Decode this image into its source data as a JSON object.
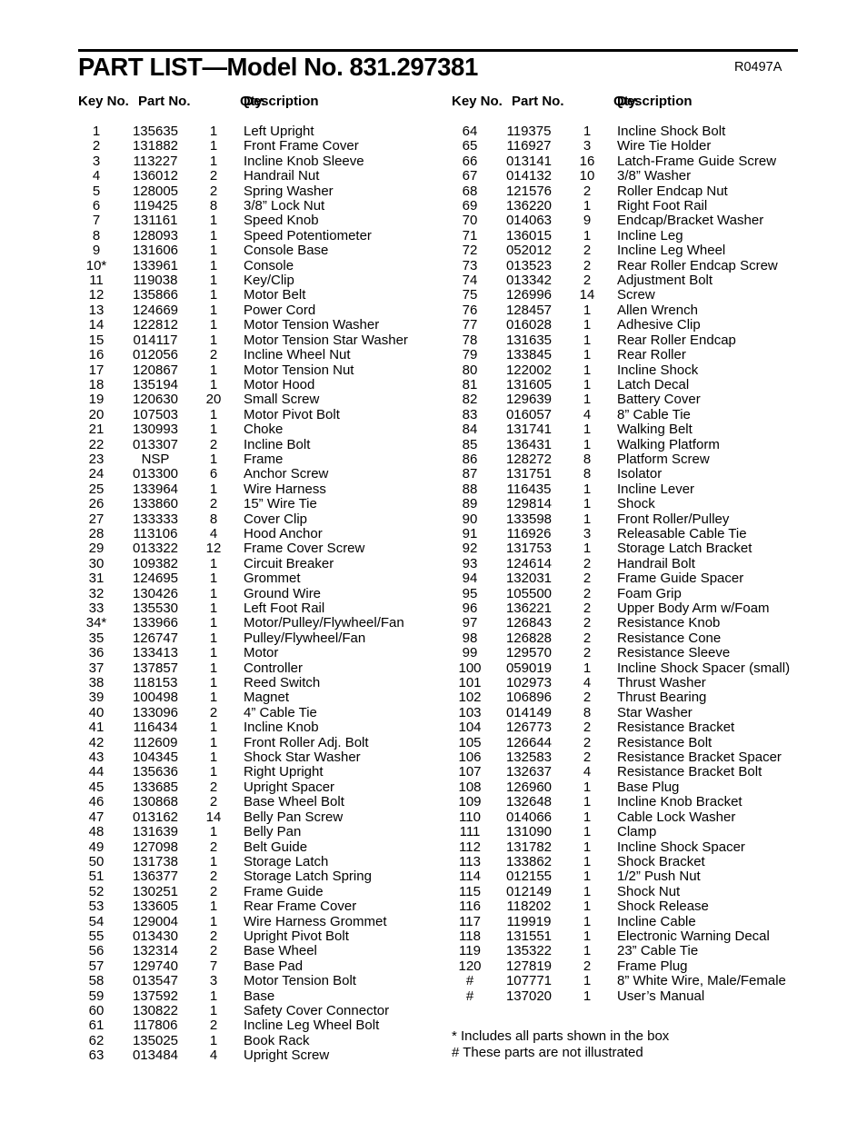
{
  "header": {
    "title": "PART LIST—Model No. 831.297381",
    "revision_code": "R0497A"
  },
  "columns": {
    "key_no": "Key No.",
    "part_no": "Part No.",
    "qty": "Qty.",
    "description": "Description"
  },
  "footnotes": [
    "* Includes all parts shown in the box",
    "# These parts are not illustrated"
  ],
  "parts_left": [
    {
      "key": "1",
      "part": "135635",
      "qty": "1",
      "desc": "Left Upright"
    },
    {
      "key": "2",
      "part": "131882",
      "qty": "1",
      "desc": "Front Frame Cover"
    },
    {
      "key": "3",
      "part": "113227",
      "qty": "1",
      "desc": "Incline Knob Sleeve"
    },
    {
      "key": "4",
      "part": "136012",
      "qty": "2",
      "desc": "Handrail Nut"
    },
    {
      "key": "5",
      "part": "128005",
      "qty": "2",
      "desc": "Spring Washer"
    },
    {
      "key": "6",
      "part": "119425",
      "qty": "8",
      "desc": "3/8” Lock Nut"
    },
    {
      "key": "7",
      "part": "131161",
      "qty": "1",
      "desc": "Speed Knob"
    },
    {
      "key": "8",
      "part": "128093",
      "qty": "1",
      "desc": "Speed Potentiometer"
    },
    {
      "key": "9",
      "part": "131606",
      "qty": "1",
      "desc": "Console Base"
    },
    {
      "key": "10*",
      "part": "133961",
      "qty": "1",
      "desc": "Console"
    },
    {
      "key": "11",
      "part": "119038",
      "qty": "1",
      "desc": "Key/Clip"
    },
    {
      "key": "12",
      "part": "135866",
      "qty": "1",
      "desc": "Motor Belt"
    },
    {
      "key": "13",
      "part": "124669",
      "qty": "1",
      "desc": "Power Cord"
    },
    {
      "key": "14",
      "part": "122812",
      "qty": "1",
      "desc": "Motor Tension Washer"
    },
    {
      "key": "15",
      "part": "014117",
      "qty": "1",
      "desc": "Motor Tension Star Washer"
    },
    {
      "key": "16",
      "part": "012056",
      "qty": "2",
      "desc": "Incline Wheel Nut"
    },
    {
      "key": "17",
      "part": "120867",
      "qty": "1",
      "desc": "Motor Tension Nut"
    },
    {
      "key": "18",
      "part": "135194",
      "qty": "1",
      "desc": "Motor Hood"
    },
    {
      "key": "19",
      "part": "120630",
      "qty": "20",
      "desc": "Small Screw"
    },
    {
      "key": "20",
      "part": "107503",
      "qty": "1",
      "desc": "Motor Pivot Bolt"
    },
    {
      "key": "21",
      "part": "130993",
      "qty": "1",
      "desc": "Choke"
    },
    {
      "key": "22",
      "part": "013307",
      "qty": "2",
      "desc": "Incline Bolt"
    },
    {
      "key": "23",
      "part": "NSP",
      "qty": "1",
      "desc": "Frame"
    },
    {
      "key": "24",
      "part": "013300",
      "qty": "6",
      "desc": "Anchor Screw"
    },
    {
      "key": "25",
      "part": "133964",
      "qty": "1",
      "desc": "Wire Harness"
    },
    {
      "key": "26",
      "part": "133860",
      "qty": "2",
      "desc": "15” Wire Tie"
    },
    {
      "key": "27",
      "part": "133333",
      "qty": "8",
      "desc": "Cover Clip"
    },
    {
      "key": "28",
      "part": "113106",
      "qty": "4",
      "desc": "Hood Anchor"
    },
    {
      "key": "29",
      "part": "013322",
      "qty": "12",
      "desc": "Frame Cover Screw"
    },
    {
      "key": "30",
      "part": "109382",
      "qty": "1",
      "desc": "Circuit Breaker"
    },
    {
      "key": "31",
      "part": "124695",
      "qty": "1",
      "desc": "Grommet"
    },
    {
      "key": "32",
      "part": "130426",
      "qty": "1",
      "desc": "Ground Wire"
    },
    {
      "key": "33",
      "part": "135530",
      "qty": "1",
      "desc": "Left Foot Rail"
    },
    {
      "key": "34*",
      "part": "133966",
      "qty": "1",
      "desc": "Motor/Pulley/Flywheel/Fan"
    },
    {
      "key": "35",
      "part": "126747",
      "qty": "1",
      "desc": "Pulley/Flywheel/Fan"
    },
    {
      "key": "36",
      "part": "133413",
      "qty": "1",
      "desc": "Motor"
    },
    {
      "key": "37",
      "part": "137857",
      "qty": "1",
      "desc": "Controller"
    },
    {
      "key": "38",
      "part": "118153",
      "qty": "1",
      "desc": "Reed Switch"
    },
    {
      "key": "39",
      "part": "100498",
      "qty": "1",
      "desc": "Magnet"
    },
    {
      "key": "40",
      "part": "133096",
      "qty": "2",
      "desc": "4” Cable Tie"
    },
    {
      "key": "41",
      "part": "116434",
      "qty": "1",
      "desc": "Incline Knob"
    },
    {
      "key": "42",
      "part": "112609",
      "qty": "1",
      "desc": "Front Roller Adj. Bolt"
    },
    {
      "key": "43",
      "part": "104345",
      "qty": "1",
      "desc": "Shock Star Washer"
    },
    {
      "key": "44",
      "part": "135636",
      "qty": "1",
      "desc": "Right Upright"
    },
    {
      "key": "45",
      "part": "133685",
      "qty": "2",
      "desc": "Upright Spacer"
    },
    {
      "key": "46",
      "part": "130868",
      "qty": "2",
      "desc": "Base Wheel Bolt"
    },
    {
      "key": "47",
      "part": "013162",
      "qty": "14",
      "desc": "Belly Pan Screw"
    },
    {
      "key": "48",
      "part": "131639",
      "qty": "1",
      "desc": "Belly Pan"
    },
    {
      "key": "49",
      "part": "127098",
      "qty": "2",
      "desc": "Belt Guide"
    },
    {
      "key": "50",
      "part": "131738",
      "qty": "1",
      "desc": "Storage Latch"
    },
    {
      "key": "51",
      "part": "136377",
      "qty": "2",
      "desc": "Storage Latch Spring"
    },
    {
      "key": "52",
      "part": "130251",
      "qty": "2",
      "desc": "Frame Guide"
    },
    {
      "key": "53",
      "part": "133605",
      "qty": "1",
      "desc": "Rear Frame Cover"
    },
    {
      "key": "54",
      "part": "129004",
      "qty": "1",
      "desc": "Wire Harness Grommet"
    },
    {
      "key": "55",
      "part": "013430",
      "qty": "2",
      "desc": "Upright Pivot Bolt"
    },
    {
      "key": "56",
      "part": "132314",
      "qty": "2",
      "desc": "Base Wheel"
    },
    {
      "key": "57",
      "part": "129740",
      "qty": "7",
      "desc": "Base Pad"
    },
    {
      "key": "58",
      "part": "013547",
      "qty": "3",
      "desc": "Motor Tension Bolt"
    },
    {
      "key": "59",
      "part": "137592",
      "qty": "1",
      "desc": "Base"
    },
    {
      "key": "60",
      "part": "130822",
      "qty": "1",
      "desc": "Safety Cover Connector"
    },
    {
      "key": "61",
      "part": "117806",
      "qty": "2",
      "desc": "Incline Leg Wheel Bolt"
    },
    {
      "key": "62",
      "part": "135025",
      "qty": "1",
      "desc": "Book Rack"
    },
    {
      "key": "63",
      "part": "013484",
      "qty": "4",
      "desc": "Upright Screw"
    }
  ],
  "parts_right": [
    {
      "key": "64",
      "part": "119375",
      "qty": "1",
      "desc": "Incline Shock Bolt"
    },
    {
      "key": "65",
      "part": "116927",
      "qty": "3",
      "desc": "Wire Tie Holder"
    },
    {
      "key": "66",
      "part": "013141",
      "qty": "16",
      "desc": "Latch-Frame Guide Screw"
    },
    {
      "key": "67",
      "part": "014132",
      "qty": "10",
      "desc": "3/8” Washer"
    },
    {
      "key": "68",
      "part": "121576",
      "qty": "2",
      "desc": "Roller Endcap Nut"
    },
    {
      "key": "69",
      "part": "136220",
      "qty": "1",
      "desc": "Right Foot Rail"
    },
    {
      "key": "70",
      "part": "014063",
      "qty": "9",
      "desc": "Endcap/Bracket Washer"
    },
    {
      "key": "71",
      "part": "136015",
      "qty": "1",
      "desc": "Incline Leg"
    },
    {
      "key": "72",
      "part": "052012",
      "qty": "2",
      "desc": "Incline Leg Wheel"
    },
    {
      "key": "73",
      "part": "013523",
      "qty": "2",
      "desc": "Rear Roller Endcap Screw"
    },
    {
      "key": "74",
      "part": "013342",
      "qty": "2",
      "desc": "Adjustment Bolt"
    },
    {
      "key": "75",
      "part": "126996",
      "qty": "14",
      "desc": "Screw"
    },
    {
      "key": "76",
      "part": "128457",
      "qty": "1",
      "desc": "Allen Wrench"
    },
    {
      "key": "77",
      "part": "016028",
      "qty": "1",
      "desc": "Adhesive Clip"
    },
    {
      "key": "78",
      "part": "131635",
      "qty": "1",
      "desc": "Rear Roller Endcap"
    },
    {
      "key": "79",
      "part": "133845",
      "qty": "1",
      "desc": "Rear Roller"
    },
    {
      "key": "80",
      "part": "122002",
      "qty": "1",
      "desc": "Incline Shock"
    },
    {
      "key": "81",
      "part": "131605",
      "qty": "1",
      "desc": "Latch Decal"
    },
    {
      "key": "82",
      "part": "129639",
      "qty": "1",
      "desc": "Battery Cover"
    },
    {
      "key": "83",
      "part": "016057",
      "qty": "4",
      "desc": "8” Cable Tie"
    },
    {
      "key": "84",
      "part": "131741",
      "qty": "1",
      "desc": "Walking Belt"
    },
    {
      "key": "85",
      "part": "136431",
      "qty": "1",
      "desc": "Walking Platform"
    },
    {
      "key": "86",
      "part": "128272",
      "qty": "8",
      "desc": "Platform Screw"
    },
    {
      "key": "87",
      "part": "131751",
      "qty": "8",
      "desc": "Isolator"
    },
    {
      "key": "88",
      "part": "116435",
      "qty": "1",
      "desc": "Incline Lever"
    },
    {
      "key": "89",
      "part": "129814",
      "qty": "1",
      "desc": "Shock"
    },
    {
      "key": "90",
      "part": "133598",
      "qty": "1",
      "desc": "Front Roller/Pulley"
    },
    {
      "key": "91",
      "part": "116926",
      "qty": "3",
      "desc": "Releasable Cable Tie"
    },
    {
      "key": "92",
      "part": "131753",
      "qty": "1",
      "desc": "Storage Latch Bracket"
    },
    {
      "key": "93",
      "part": "124614",
      "qty": "2",
      "desc": "Handrail Bolt"
    },
    {
      "key": "94",
      "part": "132031",
      "qty": "2",
      "desc": "Frame Guide Spacer"
    },
    {
      "key": "95",
      "part": "105500",
      "qty": "2",
      "desc": "Foam Grip"
    },
    {
      "key": "96",
      "part": "136221",
      "qty": "2",
      "desc": "Upper Body Arm w/Foam"
    },
    {
      "key": "97",
      "part": "126843",
      "qty": "2",
      "desc": "Resistance Knob"
    },
    {
      "key": "98",
      "part": "126828",
      "qty": "2",
      "desc": "Resistance Cone"
    },
    {
      "key": "99",
      "part": "129570",
      "qty": "2",
      "desc": "Resistance Sleeve"
    },
    {
      "key": "100",
      "part": "059019",
      "qty": "1",
      "desc": "Incline Shock Spacer (small)"
    },
    {
      "key": "101",
      "part": "102973",
      "qty": "4",
      "desc": "Thrust Washer"
    },
    {
      "key": "102",
      "part": "106896",
      "qty": "2",
      "desc": "Thrust Bearing"
    },
    {
      "key": "103",
      "part": "014149",
      "qty": "8",
      "desc": "Star Washer"
    },
    {
      "key": "104",
      "part": "126773",
      "qty": "2",
      "desc": "Resistance Bracket"
    },
    {
      "key": "105",
      "part": "126644",
      "qty": "2",
      "desc": "Resistance Bolt"
    },
    {
      "key": "106",
      "part": "132583",
      "qty": "2",
      "desc": "Resistance Bracket Spacer"
    },
    {
      "key": "107",
      "part": "132637",
      "qty": "4",
      "desc": "Resistance Bracket Bolt"
    },
    {
      "key": "108",
      "part": "126960",
      "qty": "1",
      "desc": "Base Plug"
    },
    {
      "key": "109",
      "part": "132648",
      "qty": "1",
      "desc": "Incline Knob Bracket"
    },
    {
      "key": "110",
      "part": "014066",
      "qty": "1",
      "desc": "Cable Lock Washer"
    },
    {
      "key": "111",
      "part": "131090",
      "qty": "1",
      "desc": "Clamp"
    },
    {
      "key": "112",
      "part": "131782",
      "qty": "1",
      "desc": "Incline Shock Spacer"
    },
    {
      "key": "113",
      "part": "133862",
      "qty": "1",
      "desc": "Shock Bracket"
    },
    {
      "key": "114",
      "part": "012155",
      "qty": "1",
      "desc": "1/2” Push Nut"
    },
    {
      "key": "115",
      "part": "012149",
      "qty": "1",
      "desc": "Shock Nut"
    },
    {
      "key": "116",
      "part": "118202",
      "qty": "1",
      "desc": "Shock Release"
    },
    {
      "key": "117",
      "part": "119919",
      "qty": "1",
      "desc": "Incline Cable"
    },
    {
      "key": "118",
      "part": "131551",
      "qty": "1",
      "desc": "Electronic Warning Decal"
    },
    {
      "key": "119",
      "part": "135322",
      "qty": "1",
      "desc": "23” Cable Tie"
    },
    {
      "key": "120",
      "part": "127819",
      "qty": "2",
      "desc": "Frame Plug"
    },
    {
      "key": "#",
      "part": "107771",
      "qty": "1",
      "desc": "8” White Wire, Male/Female"
    },
    {
      "key": "#",
      "part": "137020",
      "qty": "1",
      "desc": "User’s Manual"
    }
  ]
}
